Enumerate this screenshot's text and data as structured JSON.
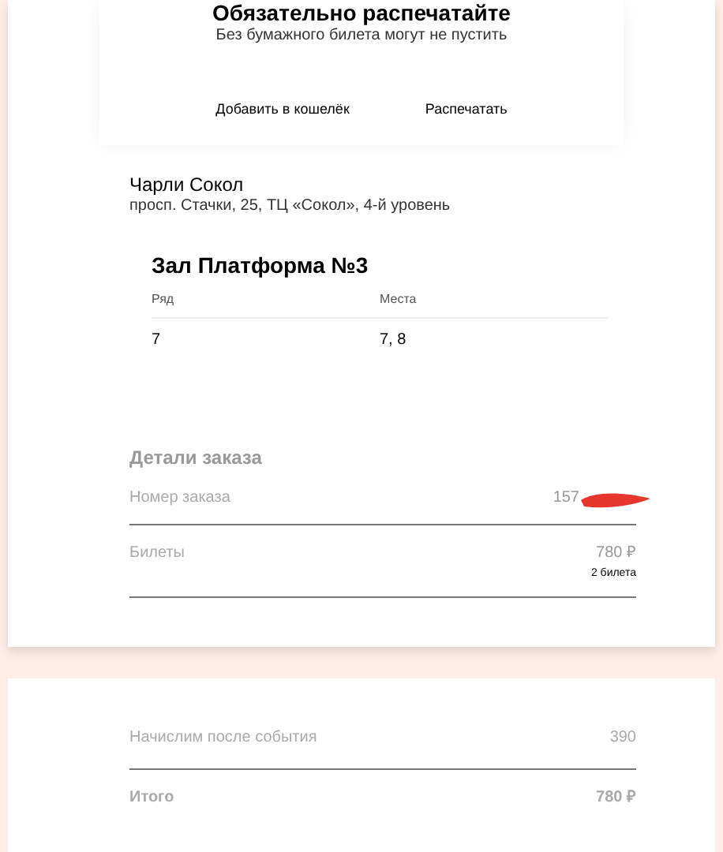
{
  "ticket": {
    "title": "Обязательно распечатайте",
    "subtitle": "Без бумажного билета могут не пустить",
    "actions": [
      "Добавить в кошелёк",
      "Распечатать"
    ]
  },
  "venue": {
    "name": "Чарли Сокол",
    "address": "просп. Стачки, 25, ТЦ «Сокол», 4-й уровень"
  },
  "hall": {
    "title": "Зал Платформа №3",
    "columns": [
      "Ряд",
      "Места"
    ],
    "row": [
      "7",
      "7, 8"
    ]
  },
  "order": {
    "title": "Детали заказа",
    "rows": [
      {
        "label": "Номер заказа",
        "value": "157",
        "redacted": true
      },
      {
        "label": "Билеты",
        "value": "780 ₽",
        "note": "2 билета",
        "redacted": false
      }
    ]
  },
  "summary": {
    "rows": [
      {
        "label": "Начислим после события",
        "value": "390",
        "bold": false
      },
      {
        "label": "Итого",
        "value": "780 ₽",
        "bold": true
      }
    ]
  }
}
